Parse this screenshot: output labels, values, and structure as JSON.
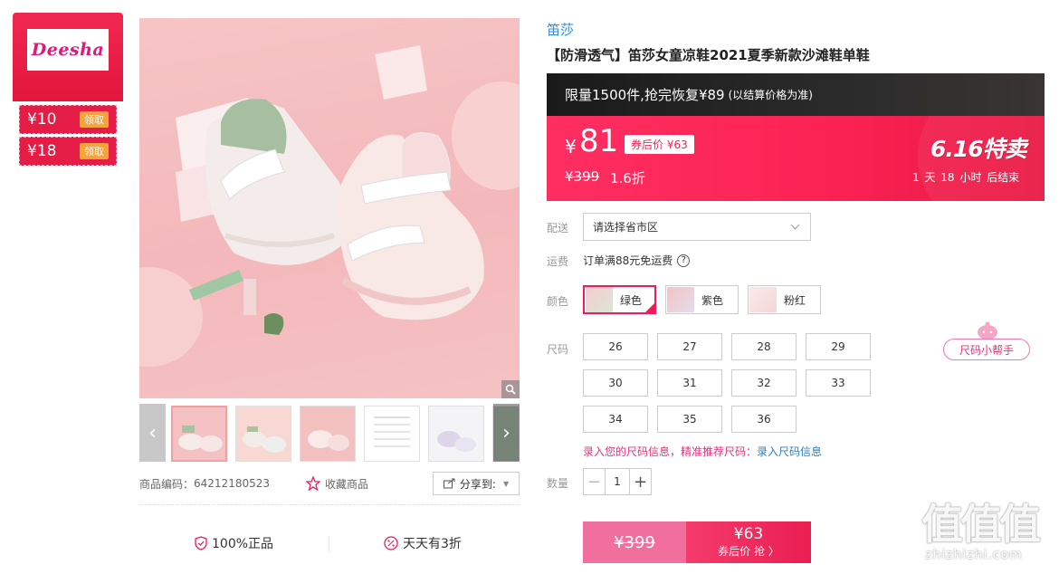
{
  "store": {
    "logo_text": "Deesha",
    "coupons": [
      {
        "amount": "¥10",
        "action": "领取"
      },
      {
        "amount": "¥18",
        "action": "领取"
      }
    ]
  },
  "gallery": {
    "thumbnails": [
      "thumbnail-green-sandals",
      "thumbnail-green-sandals-2",
      "thumbnail-pink-sandals",
      "thumbnail-size-chart",
      "thumbnail-purple-sandals",
      "thumbnail-partial"
    ],
    "product_code_label": "商品编码：",
    "product_code": "64212180523",
    "favorite_label": "收藏商品",
    "share_label": "分享到:"
  },
  "guarantees": [
    "100%正品",
    "天天有3折"
  ],
  "product": {
    "brand": "笛莎",
    "title": "【防滑透气】笛莎女童凉鞋2021夏季新款沙滩鞋单鞋"
  },
  "promo": {
    "main": "限量1500件,抢完恢复¥89",
    "sub": "(以结算价格为准)"
  },
  "price": {
    "currency": "¥",
    "current": "81",
    "after_coupon": "券后价 ¥63",
    "original": "¥399",
    "discount": "1.6折",
    "event_title": "6.16特卖",
    "countdown": "1 天 18 小时 后结束"
  },
  "delivery": {
    "label": "配送",
    "placeholder": "请选择省市区"
  },
  "shipping": {
    "label": "运费",
    "text": "订单满88元免运费"
  },
  "colors": {
    "label": "颜色",
    "options": [
      {
        "name": "绿色",
        "selected": true
      },
      {
        "name": "紫色",
        "selected": false
      },
      {
        "name": "粉红",
        "selected": false
      }
    ]
  },
  "sizes": {
    "label": "尺码",
    "options": [
      "26",
      "27",
      "28",
      "29",
      "30",
      "31",
      "32",
      "33",
      "34",
      "35",
      "36"
    ],
    "helper": "尺码小帮手",
    "note_prefix": "录入您的尺码信息，精准推荐尺码：",
    "note_link": "录入尺码信息"
  },
  "quantity": {
    "label": "数量",
    "value": "1"
  },
  "buy": {
    "original": "¥399",
    "after_price": "¥63",
    "after_label": "券后价 抢 〉"
  },
  "watermark": {
    "big": "值值值",
    "small": "zhizhizhi.com"
  },
  "theme": {
    "accent": "#f0244f",
    "pink": "#e8317f",
    "link_blue": "#2d8cd9",
    "promo_dark": "#1a1a1a"
  }
}
